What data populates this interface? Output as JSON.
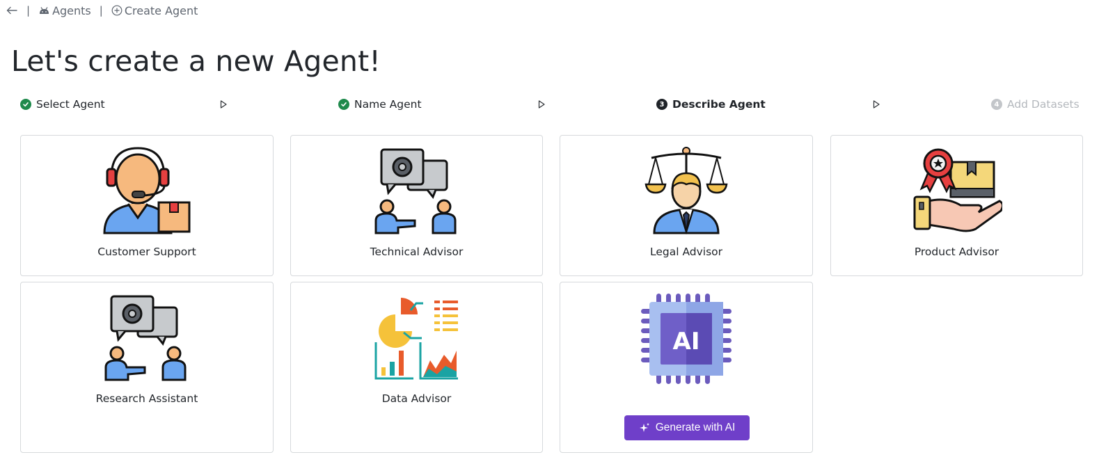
{
  "breadcrumb": {
    "back_icon": "arrow-left-icon",
    "agents_label": "Agents",
    "agents_icon": "robot-icon",
    "create_label": "Create Agent",
    "create_icon": "plus-circle-icon"
  },
  "title": "Let's create a new Agent!",
  "steps": [
    {
      "label": "Select Agent",
      "status": "done"
    },
    {
      "label": "Name Agent",
      "status": "done"
    },
    {
      "label": "Describe Agent",
      "status": "current",
      "number": "3"
    },
    {
      "label": "Add Datasets",
      "status": "upcoming",
      "number": "4"
    }
  ],
  "cards": [
    {
      "label": "Customer Support",
      "icon": "customer-support-icon"
    },
    {
      "label": "Technical Advisor",
      "icon": "technical-advisor-icon"
    },
    {
      "label": "Legal Advisor",
      "icon": "legal-advisor-icon"
    },
    {
      "label": "Product Advisor",
      "icon": "product-advisor-icon"
    },
    {
      "label": "Research Assistant",
      "icon": "research-assistant-icon"
    },
    {
      "label": "Data Advisor",
      "icon": "data-advisor-icon"
    },
    {
      "icon": "ai-chip-icon",
      "button_label": "Generate with AI",
      "button_icon": "sparkle-icon"
    }
  ],
  "colors": {
    "done": "#1f8a4c",
    "accent": "#6f3fc9",
    "upcoming": "#b4b8bd"
  }
}
